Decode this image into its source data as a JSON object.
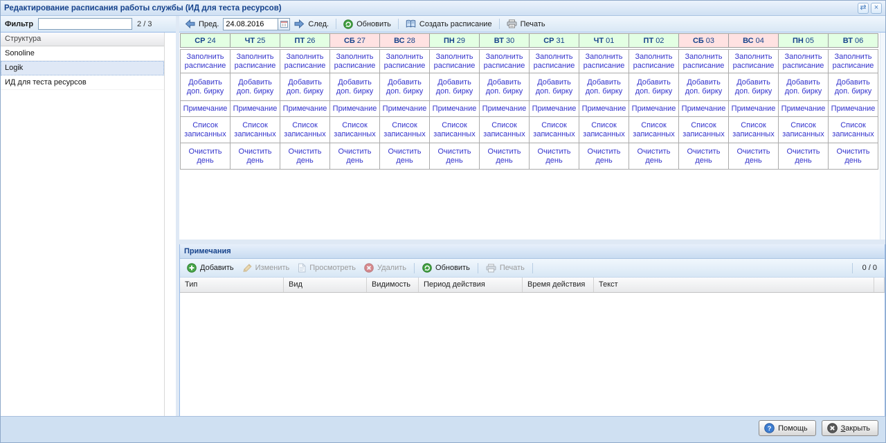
{
  "window": {
    "title": "Редактирование расписания работы службы (ИД для теста ресурсов)",
    "tools": [
      {
        "name": "refresh-window",
        "glyph": "⇄"
      },
      {
        "name": "close-window",
        "glyph": "×"
      }
    ]
  },
  "left_panel": {
    "filter_label": "Фильтр",
    "filter_value": "",
    "counter": "2 / 3",
    "tree_header": "Структура",
    "items": [
      {
        "label": "Sonoline",
        "selected": false
      },
      {
        "label": "Logik",
        "selected": true
      },
      {
        "label": "ИД для теста ресурсов",
        "selected": false
      }
    ]
  },
  "toolbar": {
    "prev_label": "Пред.",
    "date_value": "24.08.2016",
    "next_label": "След.",
    "refresh_label": "Обновить",
    "create_label": "Создать расписание",
    "print_label": "Печать"
  },
  "calendar": {
    "days": [
      {
        "dow": "СР",
        "num": "24",
        "weekend": false
      },
      {
        "dow": "ЧТ",
        "num": "25",
        "weekend": false
      },
      {
        "dow": "ПТ",
        "num": "26",
        "weekend": false
      },
      {
        "dow": "СБ",
        "num": "27",
        "weekend": true
      },
      {
        "dow": "ВС",
        "num": "28",
        "weekend": true
      },
      {
        "dow": "ПН",
        "num": "29",
        "weekend": false
      },
      {
        "dow": "ВТ",
        "num": "30",
        "weekend": false
      },
      {
        "dow": "СР",
        "num": "31",
        "weekend": false
      },
      {
        "dow": "ЧТ",
        "num": "01",
        "weekend": false
      },
      {
        "dow": "ПТ",
        "num": "02",
        "weekend": false
      },
      {
        "dow": "СБ",
        "num": "03",
        "weekend": true
      },
      {
        "dow": "ВС",
        "num": "04",
        "weekend": true
      },
      {
        "dow": "ПН",
        "num": "05",
        "weekend": false
      },
      {
        "dow": "ВТ",
        "num": "06",
        "weekend": false
      }
    ],
    "actions": [
      {
        "label": "Заполнить расписание",
        "name": "fill-schedule"
      },
      {
        "label": "Добавить доп. бирку",
        "name": "add-extra-tag"
      },
      {
        "label": "Примечание",
        "name": "note"
      },
      {
        "label": "Список записанных",
        "name": "recorded-list"
      },
      {
        "label": "Очистить день",
        "name": "clear-day"
      }
    ]
  },
  "notes": {
    "title": "Примечания",
    "toolbar": [
      {
        "label": "Добавить",
        "icon": "add-icon",
        "enabled": true,
        "name": "add",
        "sep_after": false
      },
      {
        "label": "Изменить",
        "icon": "pencil-icon",
        "enabled": false,
        "name": "edit",
        "sep_after": false
      },
      {
        "label": "Просмотреть",
        "icon": "page-icon",
        "enabled": false,
        "name": "view",
        "sep_after": false
      },
      {
        "label": "Удалить",
        "icon": "delete-icon",
        "enabled": false,
        "name": "delete",
        "sep_after": true
      },
      {
        "label": "Обновить",
        "icon": "refresh-icon",
        "enabled": true,
        "name": "refresh",
        "sep_after": true
      },
      {
        "label": "Печать",
        "icon": "printer-icon",
        "enabled": false,
        "name": "print",
        "sep_after": true
      }
    ],
    "counter": "0 / 0",
    "columns": [
      "Тип",
      "Вид",
      "Видимость",
      "Период действия",
      "Время действия",
      "Текст"
    ],
    "rows": []
  },
  "footer": {
    "help_label": "Помощь",
    "close_label": "Закрыть"
  },
  "colors": {
    "header_text": "#15428b",
    "link": "#3333cc",
    "weekday_bg": "#e3ffe3",
    "weekend_bg": "#ffe2e2"
  }
}
